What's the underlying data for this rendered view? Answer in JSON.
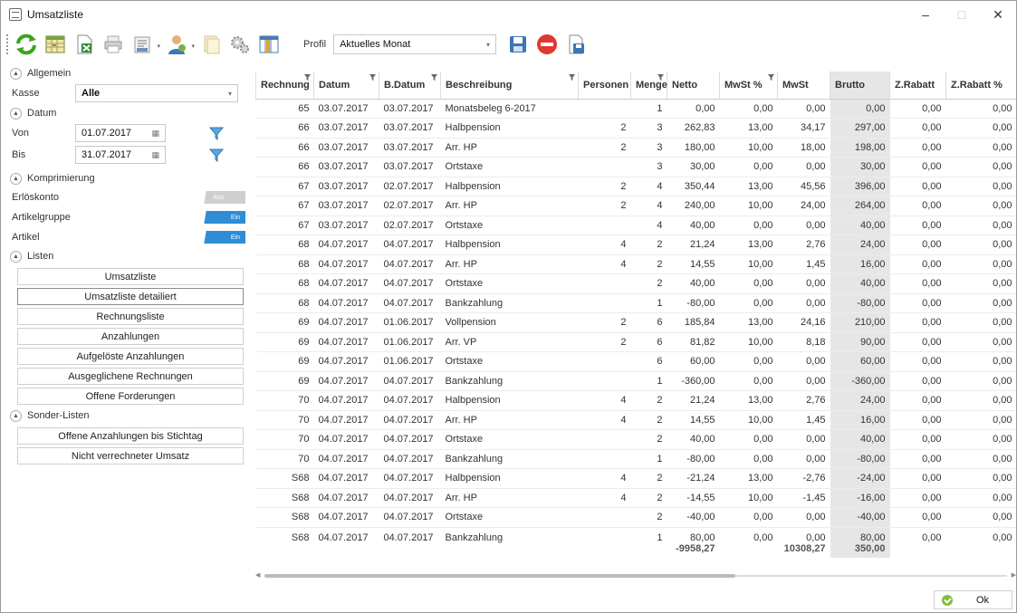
{
  "window": {
    "title": "Umsatzliste",
    "minimize": "–",
    "maximize": "□",
    "close": "✕"
  },
  "toolbar": {
    "icons": [
      "refresh-icon",
      "calendar-grid-icon",
      "excel-export-icon",
      "print-icon",
      "print-options-icon",
      "user-icon",
      "document-icon",
      "settings-icon",
      "columns-icon"
    ],
    "profile_label": "Profil",
    "profile_value": "Aktuelles Monat",
    "chevron": "▾"
  },
  "left": {
    "allgemein": {
      "title": "Allgemein",
      "kasse_label": "Kasse",
      "kasse_value": "Alle"
    },
    "datum": {
      "title": "Datum",
      "von_label": "Von",
      "von_value": "01.07.2017",
      "bis_label": "Bis",
      "bis_value": "31.07.2017"
    },
    "komprimierung": {
      "title": "Komprimierung",
      "items": [
        {
          "label": "Erlöskonto",
          "state": "Aus"
        },
        {
          "label": "Artikelgruppe",
          "state": "Ein"
        },
        {
          "label": "Artikel",
          "state": "Ein"
        }
      ]
    },
    "listen": {
      "title": "Listen",
      "buttons": [
        "Umsatzliste",
        "Umsatzliste detailiert",
        "Rechnungsliste",
        "Anzahlungen",
        "Aufgelöste Anzahlungen",
        "Ausgeglichene Rechnungen",
        "Offene Forderungen"
      ]
    },
    "sonder": {
      "title": "Sonder-Listen",
      "buttons": [
        "Offene Anzahlungen bis Stichtag",
        "Nicht verrechneter Umsatz"
      ]
    }
  },
  "table": {
    "columns": [
      "Rechnung",
      "Datum",
      "B.Datum",
      "Beschreibung",
      "Personen",
      "Menge",
      "Netto",
      "MwSt %",
      "MwSt",
      "Brutto",
      "Z.Rabatt",
      "Z.Rabatt %"
    ],
    "rows": [
      [
        "65",
        "03.07.2017",
        "03.07.2017",
        "Monatsbeleg 6-2017",
        "",
        "1",
        "0,00",
        "0,00",
        "0,00",
        "0,00",
        "0,00",
        "0,00"
      ],
      [
        "66",
        "03.07.2017",
        "03.07.2017",
        "Halbpension",
        "2",
        "3",
        "262,83",
        "13,00",
        "34,17",
        "297,00",
        "0,00",
        "0,00"
      ],
      [
        "66",
        "03.07.2017",
        "03.07.2017",
        "Arr. HP",
        "2",
        "3",
        "180,00",
        "10,00",
        "18,00",
        "198,00",
        "0,00",
        "0,00"
      ],
      [
        "66",
        "03.07.2017",
        "03.07.2017",
        "Ortstaxe",
        "",
        "3",
        "30,00",
        "0,00",
        "0,00",
        "30,00",
        "0,00",
        "0,00"
      ],
      [
        "67",
        "03.07.2017",
        "02.07.2017",
        "Halbpension",
        "2",
        "4",
        "350,44",
        "13,00",
        "45,56",
        "396,00",
        "0,00",
        "0,00"
      ],
      [
        "67",
        "03.07.2017",
        "02.07.2017",
        "Arr. HP",
        "2",
        "4",
        "240,00",
        "10,00",
        "24,00",
        "264,00",
        "0,00",
        "0,00"
      ],
      [
        "67",
        "03.07.2017",
        "02.07.2017",
        "Ortstaxe",
        "",
        "4",
        "40,00",
        "0,00",
        "0,00",
        "40,00",
        "0,00",
        "0,00"
      ],
      [
        "68",
        "04.07.2017",
        "04.07.2017",
        "Halbpension",
        "4",
        "2",
        "21,24",
        "13,00",
        "2,76",
        "24,00",
        "0,00",
        "0,00"
      ],
      [
        "68",
        "04.07.2017",
        "04.07.2017",
        "Arr. HP",
        "4",
        "2",
        "14,55",
        "10,00",
        "1,45",
        "16,00",
        "0,00",
        "0,00"
      ],
      [
        "68",
        "04.07.2017",
        "04.07.2017",
        "Ortstaxe",
        "",
        "2",
        "40,00",
        "0,00",
        "0,00",
        "40,00",
        "0,00",
        "0,00"
      ],
      [
        "68",
        "04.07.2017",
        "04.07.2017",
        "Bankzahlung",
        "",
        "1",
        "-80,00",
        "0,00",
        "0,00",
        "-80,00",
        "0,00",
        "0,00"
      ],
      [
        "69",
        "04.07.2017",
        "01.06.2017",
        "Vollpension",
        "2",
        "6",
        "185,84",
        "13,00",
        "24,16",
        "210,00",
        "0,00",
        "0,00"
      ],
      [
        "69",
        "04.07.2017",
        "01.06.2017",
        "Arr. VP",
        "2",
        "6",
        "81,82",
        "10,00",
        "8,18",
        "90,00",
        "0,00",
        "0,00"
      ],
      [
        "69",
        "04.07.2017",
        "01.06.2017",
        "Ortstaxe",
        "",
        "6",
        "60,00",
        "0,00",
        "0,00",
        "60,00",
        "0,00",
        "0,00"
      ],
      [
        "69",
        "04.07.2017",
        "04.07.2017",
        "Bankzahlung",
        "",
        "1",
        "-360,00",
        "0,00",
        "0,00",
        "-360,00",
        "0,00",
        "0,00"
      ],
      [
        "70",
        "04.07.2017",
        "04.07.2017",
        "Halbpension",
        "4",
        "2",
        "21,24",
        "13,00",
        "2,76",
        "24,00",
        "0,00",
        "0,00"
      ],
      [
        "70",
        "04.07.2017",
        "04.07.2017",
        "Arr. HP",
        "4",
        "2",
        "14,55",
        "10,00",
        "1,45",
        "16,00",
        "0,00",
        "0,00"
      ],
      [
        "70",
        "04.07.2017",
        "04.07.2017",
        "Ortstaxe",
        "",
        "2",
        "40,00",
        "0,00",
        "0,00",
        "40,00",
        "0,00",
        "0,00"
      ],
      [
        "70",
        "04.07.2017",
        "04.07.2017",
        "Bankzahlung",
        "",
        "1",
        "-80,00",
        "0,00",
        "0,00",
        "-80,00",
        "0,00",
        "0,00"
      ],
      [
        "S68",
        "04.07.2017",
        "04.07.2017",
        "Halbpension",
        "4",
        "2",
        "-21,24",
        "13,00",
        "-2,76",
        "-24,00",
        "0,00",
        "0,00"
      ],
      [
        "S68",
        "04.07.2017",
        "04.07.2017",
        "Arr. HP",
        "4",
        "2",
        "-14,55",
        "10,00",
        "-1,45",
        "-16,00",
        "0,00",
        "0,00"
      ],
      [
        "S68",
        "04.07.2017",
        "04.07.2017",
        "Ortstaxe",
        "",
        "2",
        "-40,00",
        "0,00",
        "0,00",
        "-40,00",
        "0,00",
        "0,00"
      ],
      [
        "S68",
        "04.07.2017",
        "04.07.2017",
        "Bankzahlung",
        "",
        "1",
        "80,00",
        "0,00",
        "0,00",
        "80,00",
        "0,00",
        "0,00"
      ]
    ],
    "totals": {
      "netto": "-9958,27",
      "mwst": "10308,27",
      "brutto": "350,00"
    }
  },
  "footer": {
    "ok_label": "Ok"
  }
}
